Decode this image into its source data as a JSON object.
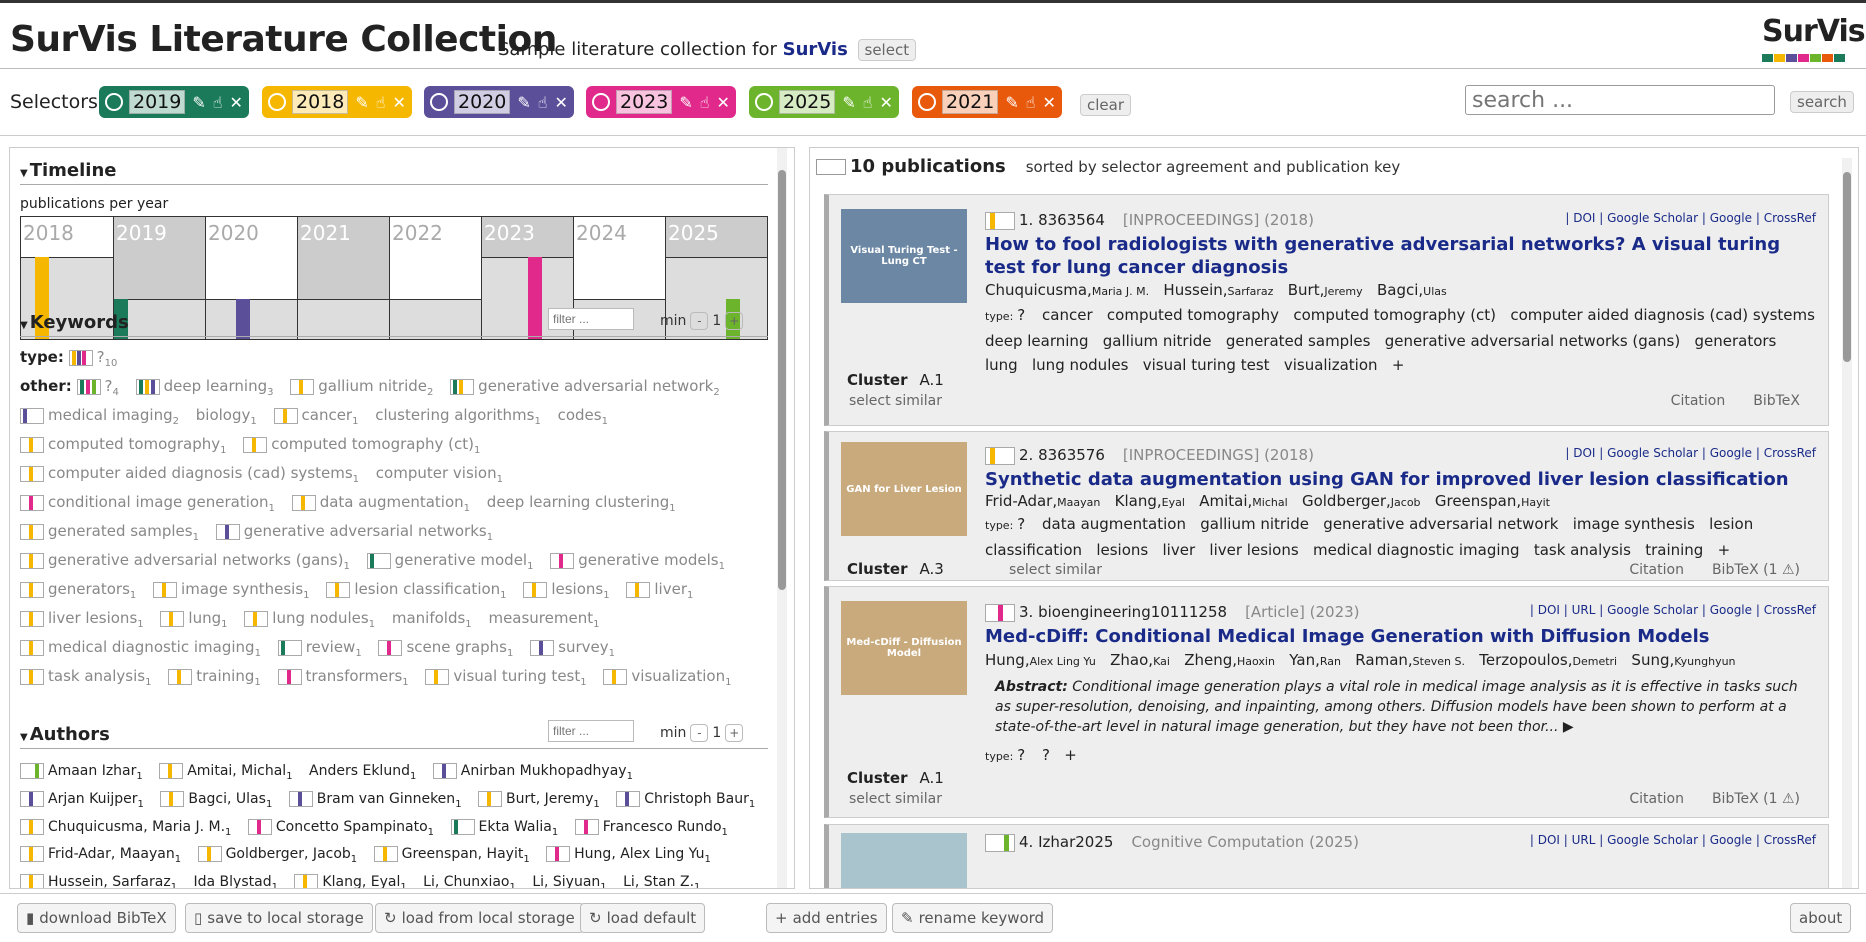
{
  "header": {
    "title": "SurVis Literature Collection",
    "subtitle_prefix": "Sample literature collection for",
    "subtitle_brand": "SurVis",
    "select_label": "select",
    "logo_text": "SurVis",
    "logo_colors": [
      "#1b7a5a",
      "#f5b700",
      "#5b4f9a",
      "#e0298a",
      "#6cb42c",
      "#e8590c",
      "#1b7a5a"
    ]
  },
  "selectors": {
    "label": "Selectors",
    "items": [
      {
        "term": "2019",
        "color": "#1b7a5a"
      },
      {
        "term": "2018",
        "color": "#f5b700"
      },
      {
        "term": "2020",
        "color": "#5b4f9a"
      },
      {
        "term": "2023",
        "color": "#e0298a"
      },
      {
        "term": "2025",
        "color": "#6cb42c"
      },
      {
        "term": "2021",
        "color": "#e8590c"
      }
    ],
    "clear_label": "clear",
    "search_placeholder": "search ...",
    "search_label": "search"
  },
  "timeline": {
    "title": "Timeline",
    "subtitle": "publications per year",
    "years": [
      "2018",
      "2019",
      "2020",
      "2021",
      "2022",
      "2023",
      "2024",
      "2025"
    ]
  },
  "keywords": {
    "title": "Keywords",
    "filter_placeholder": "filter ...",
    "min_label": "min",
    "min_value": "1",
    "minus": "-",
    "plus": "+",
    "type_label": "type:",
    "type_value": "?",
    "type_count": "10",
    "other_label": "other:",
    "items": [
      {
        "label": "?",
        "count": "4"
      },
      {
        "label": "deep learning",
        "count": "3"
      },
      {
        "label": "gallium nitride",
        "count": "2"
      },
      {
        "label": "generative adversarial network",
        "count": "2"
      },
      {
        "label": "medical imaging",
        "count": "2"
      },
      {
        "label": "biology",
        "count": "1"
      },
      {
        "label": "cancer",
        "count": "1"
      },
      {
        "label": "clustering algorithms",
        "count": "1"
      },
      {
        "label": "codes",
        "count": "1"
      },
      {
        "label": "computed tomography",
        "count": "1"
      },
      {
        "label": "computed tomography (ct)",
        "count": "1"
      },
      {
        "label": "computer aided diagnosis (cad) systems",
        "count": "1"
      },
      {
        "label": "computer vision",
        "count": "1"
      },
      {
        "label": "conditional image generation",
        "count": "1"
      },
      {
        "label": "data augmentation",
        "count": "1"
      },
      {
        "label": "deep learning clustering",
        "count": "1"
      },
      {
        "label": "generated samples",
        "count": "1"
      },
      {
        "label": "generative adversarial networks",
        "count": "1"
      },
      {
        "label": "generative adversarial networks (gans)",
        "count": "1"
      },
      {
        "label": "generative model",
        "count": "1"
      },
      {
        "label": "generative models",
        "count": "1"
      },
      {
        "label": "generators",
        "count": "1"
      },
      {
        "label": "image synthesis",
        "count": "1"
      },
      {
        "label": "lesion classification",
        "count": "1"
      },
      {
        "label": "lesions",
        "count": "1"
      },
      {
        "label": "liver",
        "count": "1"
      },
      {
        "label": "liver lesions",
        "count": "1"
      },
      {
        "label": "lung",
        "count": "1"
      },
      {
        "label": "lung nodules",
        "count": "1"
      },
      {
        "label": "manifolds",
        "count": "1"
      },
      {
        "label": "measurement",
        "count": "1"
      },
      {
        "label": "medical diagnostic imaging",
        "count": "1"
      },
      {
        "label": "review",
        "count": "1"
      },
      {
        "label": "scene graphs",
        "count": "1"
      },
      {
        "label": "survey",
        "count": "1"
      },
      {
        "label": "task analysis",
        "count": "1"
      },
      {
        "label": "training",
        "count": "1"
      },
      {
        "label": "transformers",
        "count": "1"
      },
      {
        "label": "visual turing test",
        "count": "1"
      },
      {
        "label": "visualization",
        "count": "1"
      }
    ]
  },
  "authors": {
    "title": "Authors",
    "filter_placeholder": "filter ...",
    "min_label": "min",
    "min_value": "1",
    "items": [
      {
        "label": "Amaan Izhar",
        "count": "1"
      },
      {
        "label": "Amitai, Michal",
        "count": "1"
      },
      {
        "label": "Anders Eklund",
        "count": "1"
      },
      {
        "label": "Anirban Mukhopadhyay",
        "count": "1"
      },
      {
        "label": "Arjan Kuijper",
        "count": "1"
      },
      {
        "label": "Bagci, Ulas",
        "count": "1"
      },
      {
        "label": "Bram van Ginneken",
        "count": "1"
      },
      {
        "label": "Burt, Jeremy",
        "count": "1"
      },
      {
        "label": "Christoph Baur",
        "count": "1"
      },
      {
        "label": "Chuquicusma, Maria J. M.",
        "count": "1"
      },
      {
        "label": "Concetto Spampinato",
        "count": "1"
      },
      {
        "label": "Ekta Walia",
        "count": "1"
      },
      {
        "label": "Francesco Rundo",
        "count": "1"
      },
      {
        "label": "Frid-Adar, Maayan",
        "count": "1"
      },
      {
        "label": "Goldberger, Jacob",
        "count": "1"
      },
      {
        "label": "Greenspan, Hayit",
        "count": "1"
      },
      {
        "label": "Hung, Alex Ling Yu",
        "count": "1"
      },
      {
        "label": "Hussein, Sarfaraz",
        "count": "1"
      },
      {
        "label": "Ida Blystad",
        "count": "1"
      },
      {
        "label": "Klang, Eyal",
        "count": "1"
      },
      {
        "label": "Li, Chunxiao",
        "count": "1"
      },
      {
        "label": "Li, Siyuan",
        "count": "1"
      },
      {
        "label": "Li, Stan Z.",
        "count": "1"
      }
    ]
  },
  "publications": {
    "count_label": "10 publications",
    "sorted_label": "sorted by selector agreement and publication key",
    "entries": [
      {
        "index": "1.",
        "key": "8363564",
        "type": "[INPROCEEDINGS] (2018)",
        "thumb": "Visual Turing Test - Lung CT",
        "thumb_color": "#6b87a4",
        "links": "| DOI | Google Scholar | Google | CrossRef",
        "title": "How to fool radiologists with generative adversarial networks? A visual turing test for lung cancer diagnosis",
        "authors": [
          {
            "last": "Chuquicusma,",
            "first": "Maria J. M."
          },
          {
            "last": "Hussein,",
            "first": "Sarfaraz"
          },
          {
            "last": "Burt,",
            "first": "Jeremy"
          },
          {
            "last": "Bagci,",
            "first": "Ulas"
          }
        ],
        "tags_line": "cancer   computed tomography   computed tomography (ct)   computer aided diagnosis (cad) systems   deep learning   gallium nitride   generated samples   generative adversarial networks (gans)   generators   lung   lung nodules   visual turing test   visualization   +",
        "cluster": "A.1",
        "select_similar": "select similar",
        "citation": "Citation",
        "bibtex": "BibTeX"
      },
      {
        "index": "2.",
        "key": "8363576",
        "type": "[INPROCEEDINGS] (2018)",
        "thumb": "GAN for Liver Lesion",
        "thumb_color": "#c8aa7c",
        "links": "| DOI | Google Scholar | Google | CrossRef",
        "title": "Synthetic data augmentation using GAN for improved liver lesion classification",
        "authors": [
          {
            "last": "Frid-Adar,",
            "first": "Maayan"
          },
          {
            "last": "Klang,",
            "first": "Eyal"
          },
          {
            "last": "Amitai,",
            "first": "Michal"
          },
          {
            "last": "Goldberger,",
            "first": "Jacob"
          },
          {
            "last": "Greenspan,",
            "first": "Hayit"
          }
        ],
        "tags_line": "data augmentation   gallium nitride   generative adversarial network   image synthesis   lesion classification   lesions   liver   liver lesions   medical diagnostic imaging   task analysis   training   +",
        "cluster": "A.3",
        "select_similar": "select similar",
        "citation": "Citation",
        "bibtex": "BibTeX (1 ⚠)"
      },
      {
        "index": "3.",
        "key": "bioengineering10111258",
        "type": "[Article] (2023)",
        "thumb": "Med-cDiff - Diffusion Model",
        "thumb_color": "#c8aa7c",
        "links": "| DOI | URL | Google Scholar | Google | CrossRef",
        "title": "Med-cDiff: Conditional Medical Image Generation with Diffusion Models",
        "authors": [
          {
            "last": "Hung,",
            "first": "Alex Ling Yu"
          },
          {
            "last": "Zhao,",
            "first": "Kai"
          },
          {
            "last": "Zheng,",
            "first": "Haoxin"
          },
          {
            "last": "Yan,",
            "first": "Ran"
          },
          {
            "last": "Raman,",
            "first": "Steven S."
          },
          {
            "last": "Terzopoulos,",
            "first": "Demetri"
          },
          {
            "last": "Sung,",
            "first": "Kyunghyun"
          }
        ],
        "abstract_label": "Abstract:",
        "abstract": "Conditional image generation plays a vital role in medical image analysis as it is effective in tasks such as super-resolution, denoising, and inpainting, among others. Diffusion models have been shown to perform at a state-of-the-art level in natural image generation, but they have not been thor... ▶",
        "tags_line": "?   +",
        "cluster": "A.1",
        "select_similar": "select similar",
        "citation": "Citation",
        "bibtex": "BibTeX (1 ⚠)"
      },
      {
        "index": "4.",
        "key": "Izhar2025",
        "type": "Cognitive Computation (2025)",
        "thumb": "",
        "thumb_color": "#a9c4cc",
        "links": "| DOI | URL | Google Scholar | Google | CrossRef"
      }
    ]
  },
  "footer": {
    "download": "download BibTeX",
    "save": "save to local storage",
    "load": "load from local storage",
    "load_default": "load default",
    "add_entries": "add entries",
    "rename_keyword": "rename keyword",
    "about": "about"
  },
  "colors": {
    "y2018": "#f5b700",
    "y2019": "#1b7a5a",
    "y2020": "#5b4f9a",
    "y2021": "#e8590c",
    "y2023": "#e0298a",
    "y2025": "#6cb42c",
    "link": "#1a2a88"
  }
}
